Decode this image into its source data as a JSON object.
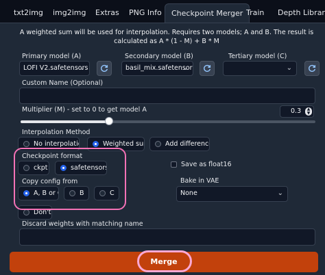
{
  "tabs": [
    "txt2img",
    "img2img",
    "Extras",
    "PNG Info",
    "Checkpoint Merger",
    "Train",
    "Depth Library"
  ],
  "active_tab": "Checkpoint Merger",
  "description": "A weighted sum will be used for interpolation. Requires two models; A and B. The result is calculated as A * (1 - M) + B * M",
  "models": {
    "primary": {
      "label": "Primary model (A)",
      "value": "LOFI V2.safetensors"
    },
    "secondary": {
      "label": "Secondary model (B)",
      "value": "basil_mix.safetensors"
    },
    "tertiary": {
      "label": "Tertiary model (C)",
      "value": ""
    }
  },
  "custom_name": {
    "label": "Custom Name (Optional)",
    "value": ""
  },
  "multiplier": {
    "label": "Multiplier (M) - set to 0 to get model A",
    "value": "0.3",
    "fraction": 0.3
  },
  "interpolation": {
    "label": "Interpolation Method",
    "options": [
      "No interpolation",
      "Weighted sum",
      "Add difference"
    ],
    "selected": "Weighted sum"
  },
  "checkpoint_format": {
    "label": "Checkpoint format",
    "options": [
      "ckpt",
      "safetensors"
    ],
    "selected": "safetensors"
  },
  "save_float16": {
    "label": "Save as float16",
    "checked": false
  },
  "copy_config": {
    "label": "Copy config from",
    "options": [
      "A, B or C",
      "B",
      "C",
      "Don't"
    ],
    "selected": "A, B or C"
  },
  "bake_vae": {
    "label": "Bake in VAE",
    "value": "None"
  },
  "discard_weights": {
    "label": "Discard weights with matching name",
    "value": ""
  },
  "merge_button": "Merge",
  "colors": {
    "accent": "#2563eb",
    "merge": "#c2410c",
    "highlight": "#f472b6"
  }
}
